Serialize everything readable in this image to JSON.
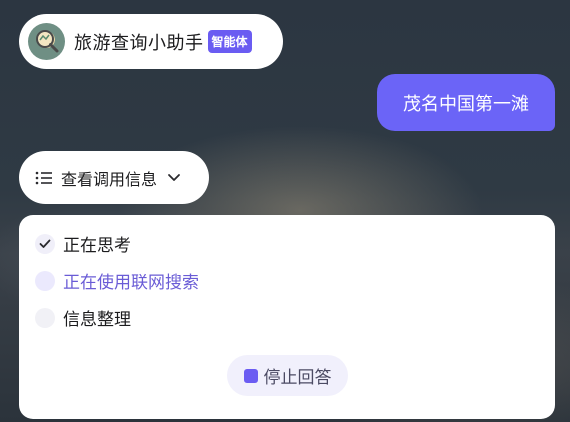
{
  "agent": {
    "name": "旅游查询小助手",
    "badge": "智能体",
    "avatar_icon": "magnifier-avatar-icon"
  },
  "user_message": {
    "text": "茂名中国第一滩"
  },
  "invoke_info": {
    "label": "查看调用信息",
    "icon": "list-icon",
    "toggle_icon": "chevron-down-icon"
  },
  "status": {
    "steps": [
      {
        "label": "正在思考",
        "state": "done"
      },
      {
        "label": "正在使用联网搜索",
        "state": "active"
      },
      {
        "label": "信息整理",
        "state": "pending"
      }
    ],
    "stop_label": "停止回答"
  },
  "colors": {
    "accent": "#6b64f7",
    "active_text": "#6a5cd6",
    "badge": "#6a5cf2"
  }
}
